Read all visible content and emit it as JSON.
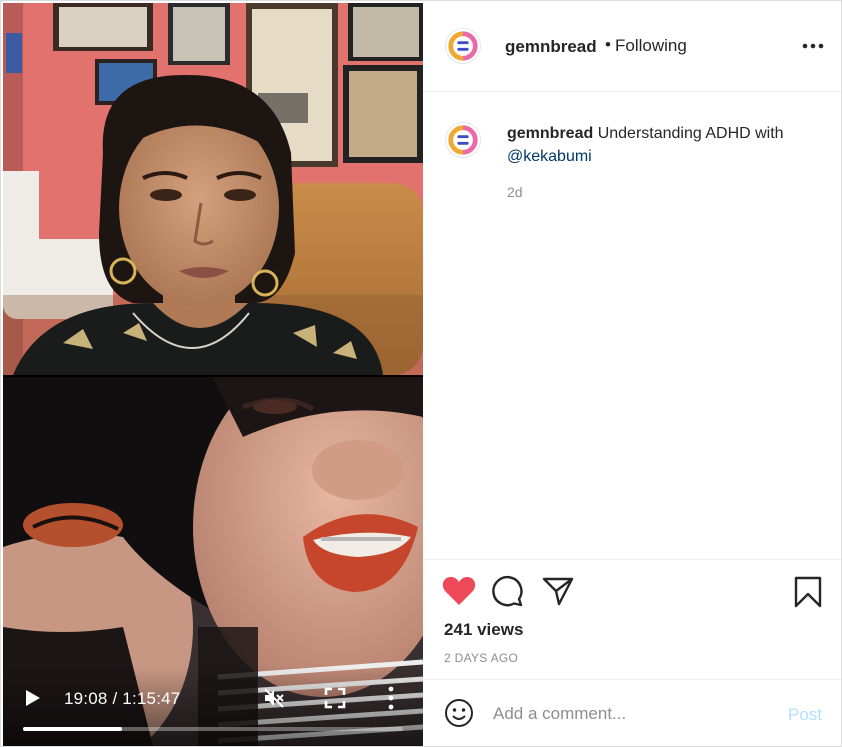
{
  "video": {
    "time_display": "19:08 / 1:15:47",
    "progress_fraction": 0.26
  },
  "header": {
    "username": "gemnbread",
    "separator": "•",
    "follow_state": "Following"
  },
  "caption": {
    "username": "gemnbread",
    "text": "Understanding ADHD with ",
    "mention": "@kekabumi",
    "time_ago": "2d"
  },
  "actions": {
    "liked": true,
    "views": "241 views",
    "date": "2 DAYS AGO"
  },
  "comment_box": {
    "placeholder": "Add a comment...",
    "post_label": "Post"
  },
  "colors": {
    "like_red": "#ed4956",
    "mention_blue": "#00376b",
    "post_disabled": "#b2dffc"
  },
  "icons": [
    "play-icon",
    "mute-icon",
    "fullscreen-icon",
    "vertical-dots-icon",
    "horizontal-dots-icon",
    "heart-icon",
    "comment-icon",
    "share-icon",
    "bookmark-icon",
    "emoji-icon"
  ]
}
